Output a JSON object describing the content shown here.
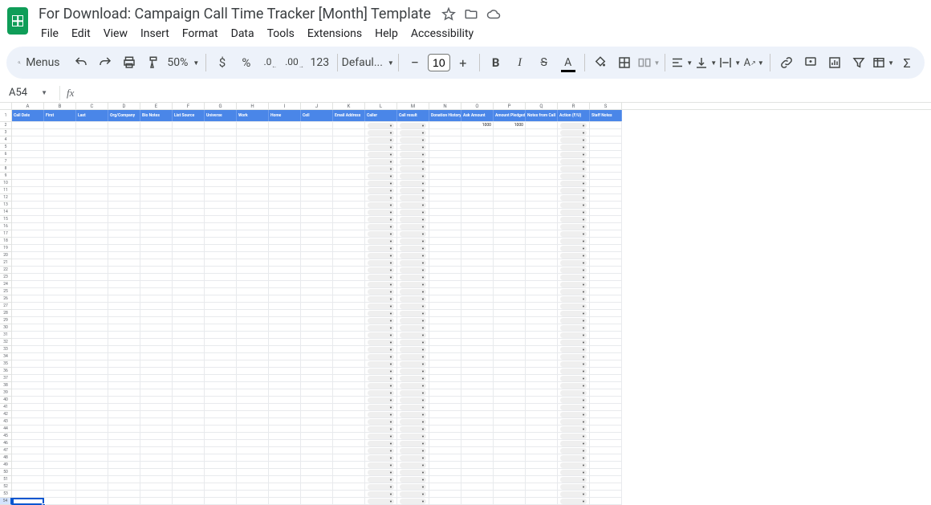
{
  "doc": {
    "title": "For Download: Campaign Call Time Tracker [Month] Template"
  },
  "menus": [
    "File",
    "Edit",
    "View",
    "Insert",
    "Format",
    "Data",
    "Tools",
    "Extensions",
    "Help",
    "Accessibility"
  ],
  "toolbar": {
    "search_label": "Menus",
    "zoom": "50%",
    "currency": "$",
    "percent": "%",
    "num_123": "123",
    "font": "Defaul...",
    "font_size": "10"
  },
  "name_box": "A54",
  "columns_letters": [
    "A",
    "B",
    "C",
    "D",
    "E",
    "F",
    "G",
    "H",
    "I",
    "J",
    "K",
    "L",
    "M",
    "N",
    "O",
    "P",
    "Q",
    "R",
    "S"
  ],
  "headers": [
    "Call Date",
    "First",
    "Last",
    "Org/Company",
    "Bio Notes",
    "List Source",
    "Universe",
    "Work",
    "Home",
    "Cell",
    "Email Address",
    "Caller",
    "Call result",
    "Donation History",
    "Ask Amount",
    "Amount Pledged",
    "Notes from Call",
    "Action (F/U)",
    "Staff Notes"
  ],
  "row2": {
    "ask_amount": "1000",
    "amount_pledged": "1000"
  },
  "dropdown_cols": [
    11,
    12,
    17
  ],
  "selected_row": 54,
  "total_rows": 54
}
